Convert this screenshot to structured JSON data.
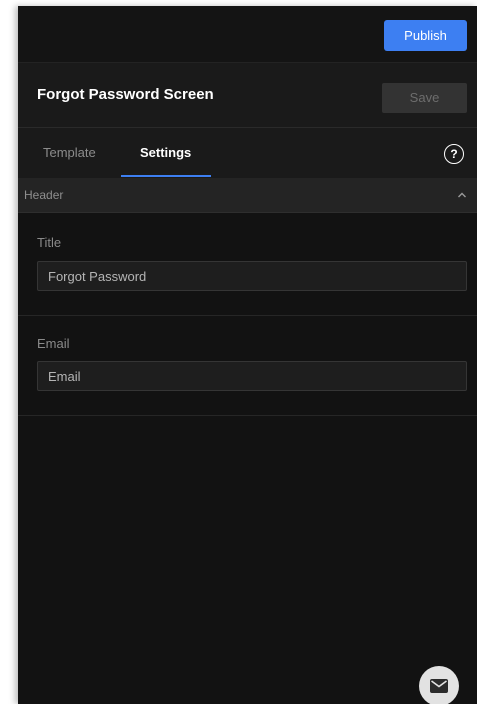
{
  "topbar": {
    "publish_label": "Publish"
  },
  "screen": {
    "title": "Forgot Password Screen",
    "save_label": "Save"
  },
  "tabs": [
    {
      "label": "Template",
      "active": false
    },
    {
      "label": "Settings",
      "active": true
    }
  ],
  "help": {
    "icon": "help-circle-icon",
    "glyph": "?"
  },
  "section": {
    "title": "Header",
    "expanded": true,
    "toggle_icon": "chevron-up-icon"
  },
  "fields": {
    "title": {
      "label": "Title",
      "value": "Forgot Password"
    },
    "email": {
      "label": "Email",
      "value": "Email"
    }
  },
  "floating_action": {
    "icon": "mail-icon"
  },
  "colors": {
    "accent": "#3d7ff2",
    "panel_background": "#121212"
  }
}
